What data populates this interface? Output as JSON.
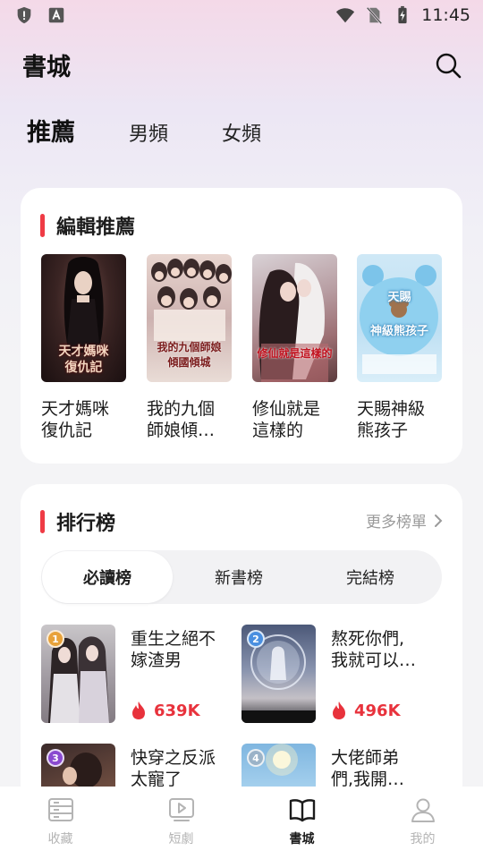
{
  "status_bar": {
    "time": "11:45"
  },
  "header": {
    "title": "書城"
  },
  "tabs": [
    {
      "label": "推薦",
      "active": true
    },
    {
      "label": "男頻",
      "active": false
    },
    {
      "label": "女頻",
      "active": false
    }
  ],
  "editor_pick": {
    "title": "編輯推薦",
    "books": [
      {
        "title": "天才媽咪\n復仇記",
        "cover_text": "天才媽咪\n復仇記"
      },
      {
        "title": "我的九個\n師娘傾…",
        "cover_text": "我的九個師娘\n傾國傾城"
      },
      {
        "title": "修仙就是\n這樣的",
        "cover_text": "修仙就是這樣的"
      },
      {
        "title": "天賜神級\n熊孩子",
        "cover_text": "天賜\n神級熊孩子"
      }
    ]
  },
  "ranking": {
    "title": "排行榜",
    "more": "更多榜單",
    "tabs": [
      {
        "label": "必讀榜",
        "active": true
      },
      {
        "label": "新書榜",
        "active": false
      },
      {
        "label": "完結榜",
        "active": false
      }
    ],
    "items": [
      {
        "rank": "1",
        "title": "重生之絕不\n嫁渣男",
        "heat": "639K"
      },
      {
        "rank": "2",
        "title": "熬死你們,\n我就可以…",
        "heat": "496K"
      },
      {
        "rank": "3",
        "title": "快穿之反派\n太寵了",
        "heat": ""
      },
      {
        "rank": "4",
        "title": "大佬師弟\n們,我開…",
        "heat": ""
      }
    ]
  },
  "bottom_nav": [
    {
      "label": "收藏",
      "icon": "bookshelf-icon",
      "active": false
    },
    {
      "label": "短劇",
      "icon": "video-icon",
      "active": false
    },
    {
      "label": "書城",
      "icon": "open-book-icon",
      "active": true
    },
    {
      "label": "我的",
      "icon": "profile-icon",
      "active": false
    }
  ],
  "colors": {
    "accent": "#ef3b45",
    "heat": "#e8323c",
    "nav_inactive": "#b4b4b4"
  }
}
